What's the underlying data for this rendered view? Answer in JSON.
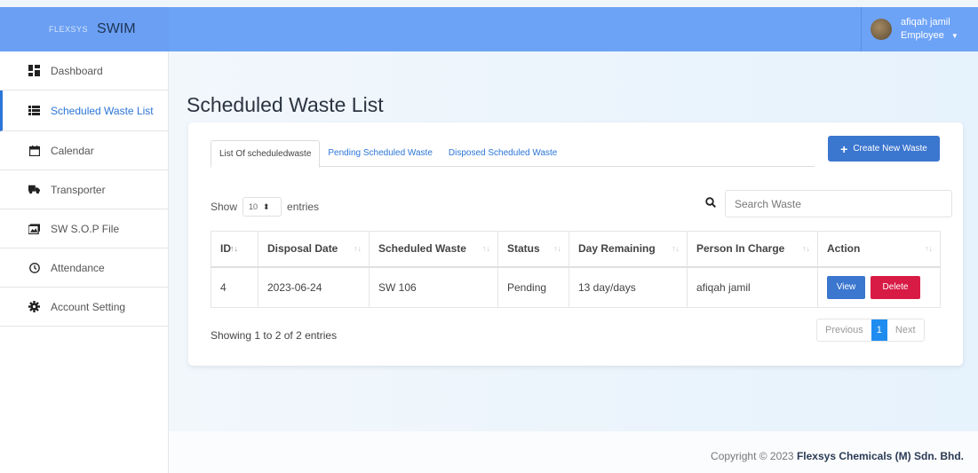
{
  "brand": {
    "logo_text": "FLEXSYS",
    "app_name": "SWIM"
  },
  "user": {
    "name": "afiqah jamil",
    "role": "Employee"
  },
  "sidebar": {
    "items": [
      {
        "label": "Dashboard",
        "icon": "dashboard-icon"
      },
      {
        "label": "Scheduled Waste List",
        "icon": "list-icon"
      },
      {
        "label": "Calendar",
        "icon": "calendar-icon"
      },
      {
        "label": "Transporter",
        "icon": "truck-icon"
      },
      {
        "label": "SW S.O.P File",
        "icon": "image-file-icon"
      },
      {
        "label": "Attendance",
        "icon": "clock-icon"
      },
      {
        "label": "Account Setting",
        "icon": "gear-icon"
      }
    ],
    "active_index": 1
  },
  "main": {
    "title": "Scheduled Waste List",
    "tabs": [
      {
        "label": "List Of scheduledwaste"
      },
      {
        "label": "Pending Scheduled Waste"
      },
      {
        "label": "Disposed Scheduled Waste"
      }
    ],
    "create_button": "Create New Waste",
    "show_label": "Show",
    "entries_value": "10",
    "entries_label": "entries",
    "search_placeholder": "Search Waste",
    "table": {
      "headers": [
        "ID",
        "Disposal Date",
        "Scheduled Waste",
        "Status",
        "Day Remaining",
        "Person In Charge",
        "Action"
      ],
      "rows": [
        {
          "id": "4",
          "disposal_date": "2023-06-24",
          "scheduled_waste": "SW 106",
          "status": "Pending",
          "day_remaining": "13 day/days",
          "person_in_charge": "afiqah jamil"
        }
      ],
      "view_label": "View",
      "delete_label": "Delete"
    },
    "info": "Showing 1 to 2 of 2 entries",
    "pagination": {
      "previous": "Previous",
      "current": "1",
      "next": "Next"
    }
  },
  "footer": {
    "prefix": "Copyright © 2023 ",
    "company": "Flexsys Chemicals (M) Sdn. Bhd."
  },
  "colors": {
    "topbar": "#6da3f6",
    "accent": "#3b76cf",
    "danger": "#d81b45",
    "active_page": "#1f8cf0"
  }
}
